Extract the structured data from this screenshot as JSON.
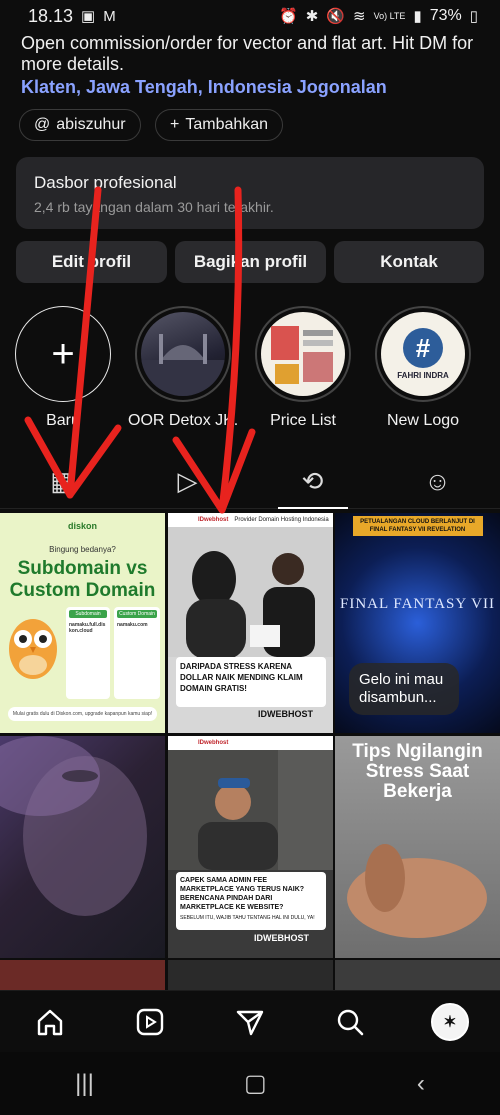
{
  "status": {
    "time": "18.13",
    "battery": "73%",
    "net": "Vo) LTE"
  },
  "profile": {
    "bio": "Open commission/order for vector and flat art. Hit DM for more details.",
    "location": "Klaten, Jawa Tengah, Indonesia Jogonalan",
    "threads_chip": "abiszuhur",
    "add_chip": "Tambahkan"
  },
  "dashboard": {
    "title": "Dasbor profesional",
    "subtitle": "2,4 rb tayangan dalam 30 hari terakhir."
  },
  "buttons": {
    "edit": "Edit profil",
    "share": "Bagikan profil",
    "contact": "Kontak"
  },
  "highlights": [
    {
      "label": "Baru"
    },
    {
      "label": "OOR Detox JK..."
    },
    {
      "label": "Price List"
    },
    {
      "label": "New Logo"
    }
  ],
  "new_logo_text": "FAHRI INDRA",
  "posts": {
    "p1": {
      "brand": "diskon",
      "question": "Bingung bedanya?",
      "title1": "Subdomain vs",
      "title2": "Custom Domain",
      "col1": "Subdomain",
      "col2": "Custom Domain",
      "ex1": "namaku.full.diskon.cloud",
      "ex2": "namaku.com",
      "footer": "Mulai gratis dulu di Diskon.com, upgrade kapanpun kamu siap!"
    },
    "p2": {
      "brand": "IDwebhost",
      "tagline": "Provider Domain Hosting Indonesia",
      "headline": "DARIPADA STRESS KARENA DOLLAR NAIK MENDING KLAIM DOMAIN GRATIS!",
      "cta": "IDWEBHOST"
    },
    "p3": {
      "top": "PETUALANGAN CLOUD BERLANJUT DI FINAL FANTASY VII REVELATION",
      "logo": "FINAL FANTASY VII",
      "caption": "Gelo ini mau disambun..."
    },
    "p5": {
      "brand": "IDwebhost",
      "headline": "CAPEK SAMA ADMIN FEE MARKETPLACE YANG TERUS NAIK? BERENCANA PINDAH DARI MARKETPLACE KE WEBSITE?",
      "sub": "SEBELUM ITU, WAJIB TAHU TENTANG HAL INI DULU, YA!",
      "cta": "IDWEBHOST"
    },
    "p6": {
      "title": "Tips Ngilangin Stress Saat Bekerja"
    }
  },
  "colors": {
    "accent_link": "#8aa2ff",
    "annotation_arrow": "#e8231e"
  }
}
